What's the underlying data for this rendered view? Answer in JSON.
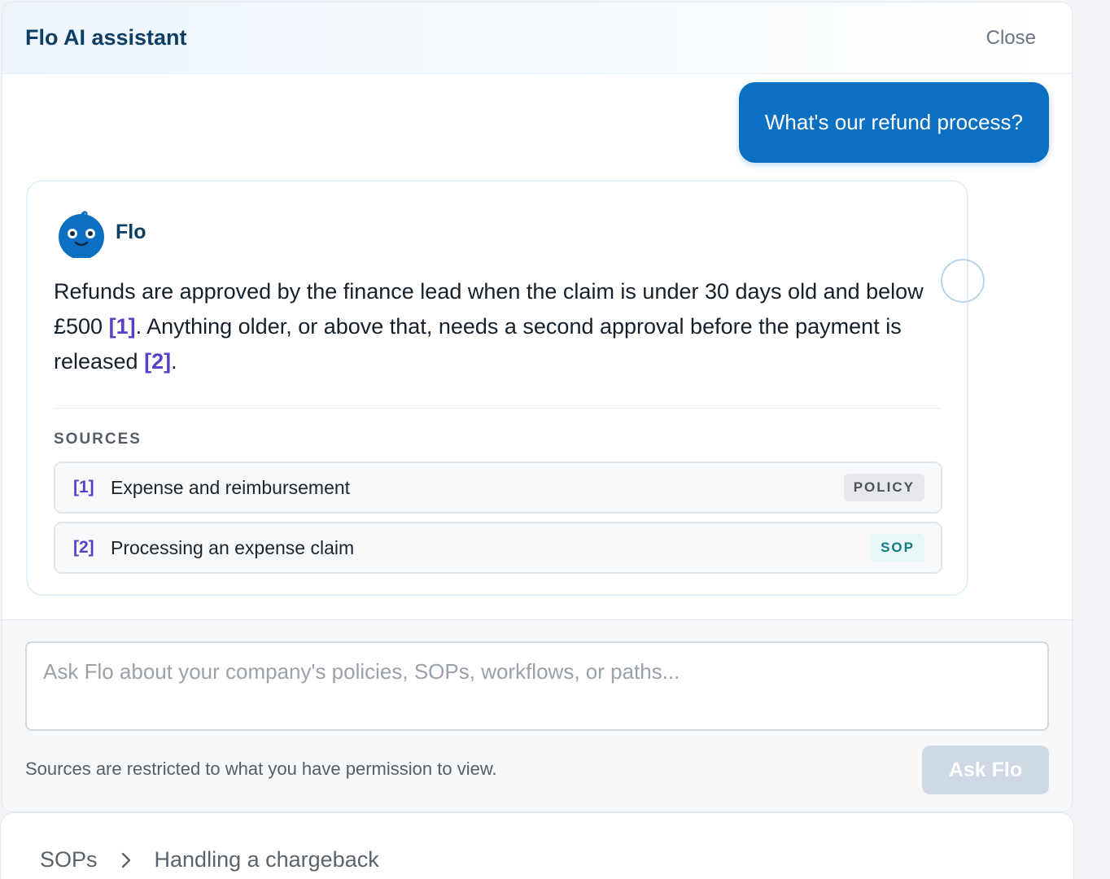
{
  "header": {
    "title": "Flo AI assistant",
    "close_label": "Close"
  },
  "user_message": "What's our refund process?",
  "answer": {
    "bot_name": "Flo",
    "text_parts": [
      "Refunds are approved by the finance lead when the claim is under 30 days old and below £500 ",
      "[1]",
      ". Anything older, or above that, needs a second approval before the payment is released ",
      "[2]",
      "."
    ],
    "sources_label": "SOURCES",
    "sources": [
      {
        "num": "[1]",
        "title": "Expense and reimbursement",
        "badge": "POLICY"
      },
      {
        "num": "[2]",
        "title": "Processing an expense claim",
        "badge": "SOP"
      }
    ]
  },
  "composer": {
    "placeholder": "Ask Flo about your company's policies, SOPs, workflows, or paths...",
    "hint": "Sources are restricted to what you have permission to view.",
    "ask_label": "Ask Flo"
  },
  "breadcrumb": {
    "items": [
      "SOPs",
      "Handling a chargeback"
    ]
  },
  "colors": {
    "brand": "#0b6fc2",
    "heading": "#0d3f66",
    "citation": "#5a3fc8",
    "sop_badge_text": "#137a85"
  }
}
